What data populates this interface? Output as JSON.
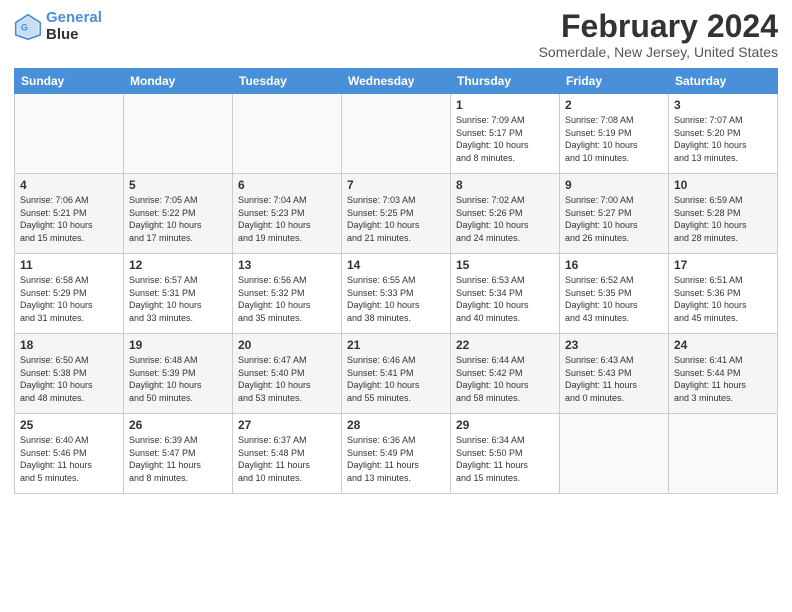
{
  "logo": {
    "text1": "General",
    "text2": "Blue"
  },
  "title": "February 2024",
  "location": "Somerdale, New Jersey, United States",
  "days_of_week": [
    "Sunday",
    "Monday",
    "Tuesday",
    "Wednesday",
    "Thursday",
    "Friday",
    "Saturday"
  ],
  "weeks": [
    [
      {
        "day": "",
        "info": ""
      },
      {
        "day": "",
        "info": ""
      },
      {
        "day": "",
        "info": ""
      },
      {
        "day": "",
        "info": ""
      },
      {
        "day": "1",
        "info": "Sunrise: 7:09 AM\nSunset: 5:17 PM\nDaylight: 10 hours\nand 8 minutes."
      },
      {
        "day": "2",
        "info": "Sunrise: 7:08 AM\nSunset: 5:19 PM\nDaylight: 10 hours\nand 10 minutes."
      },
      {
        "day": "3",
        "info": "Sunrise: 7:07 AM\nSunset: 5:20 PM\nDaylight: 10 hours\nand 13 minutes."
      }
    ],
    [
      {
        "day": "4",
        "info": "Sunrise: 7:06 AM\nSunset: 5:21 PM\nDaylight: 10 hours\nand 15 minutes."
      },
      {
        "day": "5",
        "info": "Sunrise: 7:05 AM\nSunset: 5:22 PM\nDaylight: 10 hours\nand 17 minutes."
      },
      {
        "day": "6",
        "info": "Sunrise: 7:04 AM\nSunset: 5:23 PM\nDaylight: 10 hours\nand 19 minutes."
      },
      {
        "day": "7",
        "info": "Sunrise: 7:03 AM\nSunset: 5:25 PM\nDaylight: 10 hours\nand 21 minutes."
      },
      {
        "day": "8",
        "info": "Sunrise: 7:02 AM\nSunset: 5:26 PM\nDaylight: 10 hours\nand 24 minutes."
      },
      {
        "day": "9",
        "info": "Sunrise: 7:00 AM\nSunset: 5:27 PM\nDaylight: 10 hours\nand 26 minutes."
      },
      {
        "day": "10",
        "info": "Sunrise: 6:59 AM\nSunset: 5:28 PM\nDaylight: 10 hours\nand 28 minutes."
      }
    ],
    [
      {
        "day": "11",
        "info": "Sunrise: 6:58 AM\nSunset: 5:29 PM\nDaylight: 10 hours\nand 31 minutes."
      },
      {
        "day": "12",
        "info": "Sunrise: 6:57 AM\nSunset: 5:31 PM\nDaylight: 10 hours\nand 33 minutes."
      },
      {
        "day": "13",
        "info": "Sunrise: 6:56 AM\nSunset: 5:32 PM\nDaylight: 10 hours\nand 35 minutes."
      },
      {
        "day": "14",
        "info": "Sunrise: 6:55 AM\nSunset: 5:33 PM\nDaylight: 10 hours\nand 38 minutes."
      },
      {
        "day": "15",
        "info": "Sunrise: 6:53 AM\nSunset: 5:34 PM\nDaylight: 10 hours\nand 40 minutes."
      },
      {
        "day": "16",
        "info": "Sunrise: 6:52 AM\nSunset: 5:35 PM\nDaylight: 10 hours\nand 43 minutes."
      },
      {
        "day": "17",
        "info": "Sunrise: 6:51 AM\nSunset: 5:36 PM\nDaylight: 10 hours\nand 45 minutes."
      }
    ],
    [
      {
        "day": "18",
        "info": "Sunrise: 6:50 AM\nSunset: 5:38 PM\nDaylight: 10 hours\nand 48 minutes."
      },
      {
        "day": "19",
        "info": "Sunrise: 6:48 AM\nSunset: 5:39 PM\nDaylight: 10 hours\nand 50 minutes."
      },
      {
        "day": "20",
        "info": "Sunrise: 6:47 AM\nSunset: 5:40 PM\nDaylight: 10 hours\nand 53 minutes."
      },
      {
        "day": "21",
        "info": "Sunrise: 6:46 AM\nSunset: 5:41 PM\nDaylight: 10 hours\nand 55 minutes."
      },
      {
        "day": "22",
        "info": "Sunrise: 6:44 AM\nSunset: 5:42 PM\nDaylight: 10 hours\nand 58 minutes."
      },
      {
        "day": "23",
        "info": "Sunrise: 6:43 AM\nSunset: 5:43 PM\nDaylight: 11 hours\nand 0 minutes."
      },
      {
        "day": "24",
        "info": "Sunrise: 6:41 AM\nSunset: 5:44 PM\nDaylight: 11 hours\nand 3 minutes."
      }
    ],
    [
      {
        "day": "25",
        "info": "Sunrise: 6:40 AM\nSunset: 5:46 PM\nDaylight: 11 hours\nand 5 minutes."
      },
      {
        "day": "26",
        "info": "Sunrise: 6:39 AM\nSunset: 5:47 PM\nDaylight: 11 hours\nand 8 minutes."
      },
      {
        "day": "27",
        "info": "Sunrise: 6:37 AM\nSunset: 5:48 PM\nDaylight: 11 hours\nand 10 minutes."
      },
      {
        "day": "28",
        "info": "Sunrise: 6:36 AM\nSunset: 5:49 PM\nDaylight: 11 hours\nand 13 minutes."
      },
      {
        "day": "29",
        "info": "Sunrise: 6:34 AM\nSunset: 5:50 PM\nDaylight: 11 hours\nand 15 minutes."
      },
      {
        "day": "",
        "info": ""
      },
      {
        "day": "",
        "info": ""
      }
    ]
  ]
}
